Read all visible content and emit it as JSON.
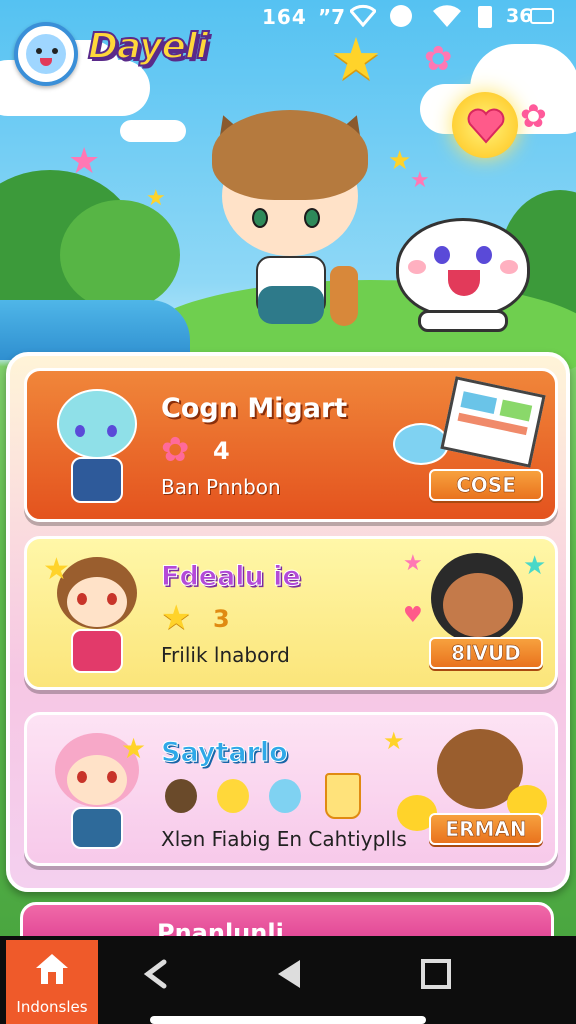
{
  "status_bar": {
    "time": "164",
    "signal": "”7",
    "battery": "36"
  },
  "header": {
    "title": "Dayeli"
  },
  "cards": [
    {
      "title": "Cogn Migart",
      "stat": "4",
      "subtitle": "Ban Pnnbon",
      "button": "COSE",
      "stat_icon": "flower-icon"
    },
    {
      "title": "Fdealu ie",
      "stat": "3",
      "subtitle": "Frilik lnabord",
      "button": "8IVUD",
      "stat_icon": "star-icon"
    },
    {
      "title": "Saytarlo",
      "subtitle": "Xlən Fiabig En Cahtiyplls",
      "button": "ERMAN"
    },
    {
      "title": "Pnanlunli"
    }
  ],
  "nav": {
    "home_label": "Indonsles"
  },
  "colors": {
    "card1": "#e4531e",
    "card2": "#fbe57a",
    "card3": "#f7c9ea",
    "card4": "#e24896",
    "button": "#e9731e",
    "home_nav": "#ef5a2a"
  }
}
